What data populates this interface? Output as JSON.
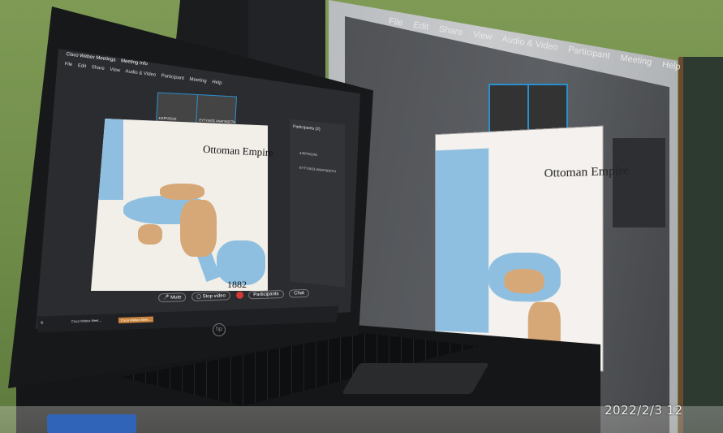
{
  "laptop_screen": {
    "app_title": "Cisco Webex Meetings",
    "meeting_info": "Meeting Info",
    "menu": [
      "File",
      "Edit",
      "Share",
      "View",
      "Audio & Video",
      "Participant",
      "Meeting",
      "Help"
    ],
    "shared_map": {
      "title": "Ottoman Empire",
      "year": "1882"
    },
    "participants_panel": {
      "header": "Participants (2)",
      "entries": [
        "4-ΕΡΓΑΣΙΑΣ",
        "ΕΥΤΥΧΙΟΣ ΑΝΑΓΝΩΣΤΗ"
      ]
    },
    "controls": {
      "mute": "Mute",
      "stop_video": "Stop video",
      "participants": "Participants",
      "chat": "Chat"
    },
    "taskbar": {
      "item1": "Cisco Webex Meet...",
      "item2": "Cisco Webex Meet..."
    }
  },
  "projection": {
    "menu": [
      "File",
      "Edit",
      "Share",
      "View",
      "Audio & Video",
      "Participant",
      "Meeting",
      "Help"
    ],
    "title": "Ottoman Empire"
  },
  "overlay": {
    "timestamp": "2022/2/3 12"
  },
  "colors": {
    "sea": "#8ebfe0",
    "ottoman_territory": "#d6a877",
    "webex_accent": "#2a90d0",
    "end_call": "#d23a33"
  }
}
